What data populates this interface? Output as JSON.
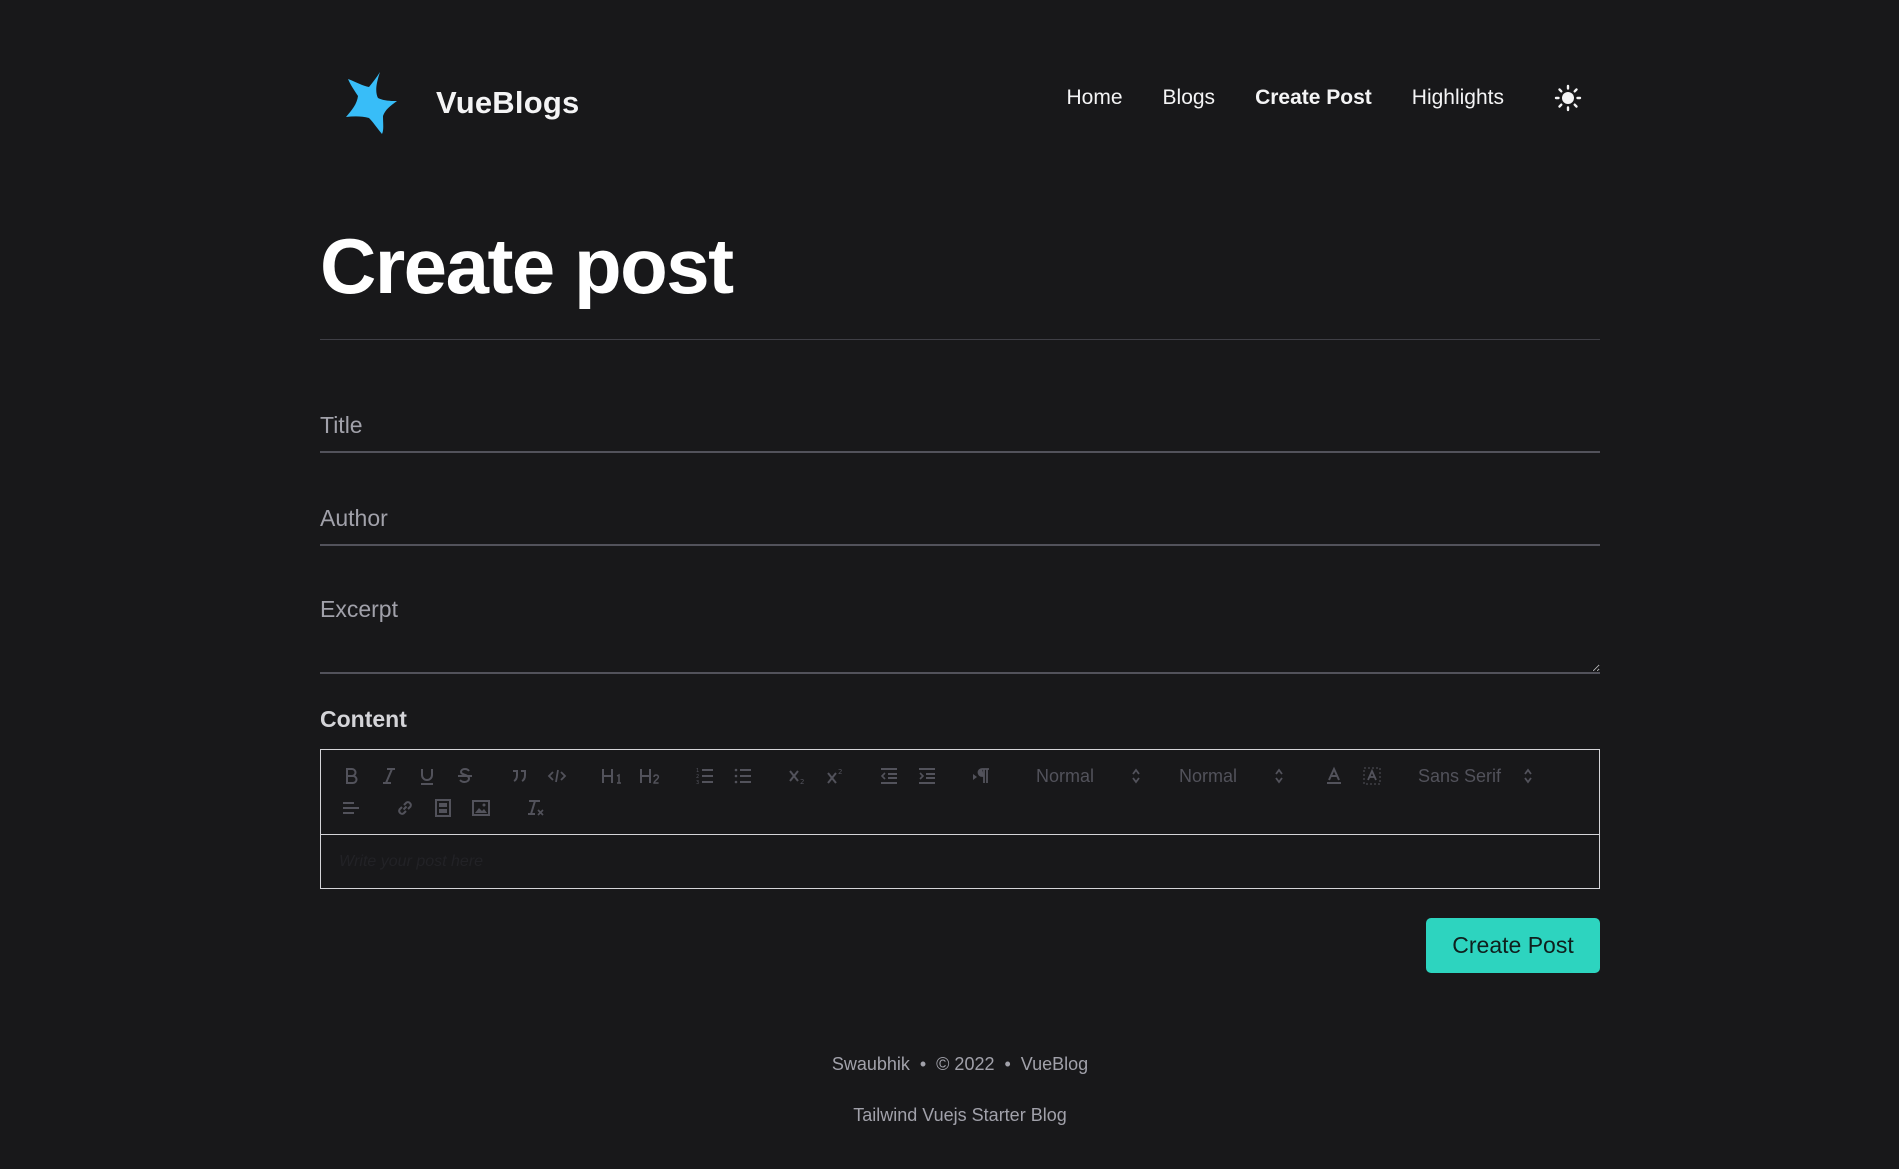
{
  "app": {
    "brand_name": "VueBlogs",
    "logo_icon": "star-logo-icon",
    "accent_color": "#2dd4bf",
    "logo_color": "#38bdf8"
  },
  "nav": {
    "items": [
      {
        "label": "Home",
        "active": false
      },
      {
        "label": "Blogs",
        "active": false
      },
      {
        "label": "Create Post",
        "active": true
      },
      {
        "label": "Highlights",
        "active": false
      }
    ],
    "theme_toggle_icon": "sun-icon"
  },
  "page": {
    "title": "Create post"
  },
  "form": {
    "title_placeholder": "Title",
    "author_placeholder": "Author",
    "excerpt_placeholder": "Excerpt",
    "content_label": "Content",
    "editor_placeholder": "Write your post here",
    "header_picker": "Normal",
    "size_picker": "Normal",
    "font_picker": "Sans Serif",
    "submit_label": "Create Post"
  },
  "footer": {
    "author": "Swaubhik",
    "sep1": "•",
    "copyright": "© 2022",
    "sep2": "•",
    "site": "VueBlog",
    "tagline": "Tailwind Vuejs Starter Blog"
  }
}
